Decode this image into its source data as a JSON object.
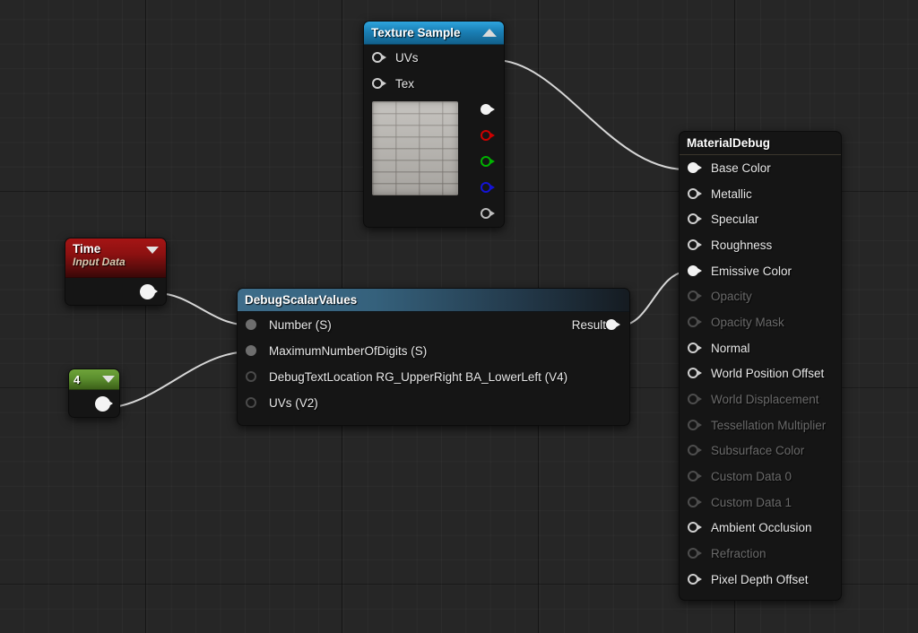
{
  "editor": {
    "name": "material-graph-editor",
    "background_color": "#262626",
    "wire_color": "#d7d7d7"
  },
  "nodes": {
    "texture_sample": {
      "title": "Texture Sample",
      "collapse_icon": "chevron-up-icon",
      "header_color": "#1a7fb5",
      "inputs": [
        {
          "label": "UVs",
          "connected": false
        },
        {
          "label": "Tex",
          "connected": false
        }
      ],
      "outputs": [
        {
          "label": "",
          "color": "#ffffff",
          "connected": true
        },
        {
          "label": "",
          "color": "#cc0000",
          "connected": false
        },
        {
          "label": "",
          "color": "#00b300",
          "connected": false
        },
        {
          "label": "",
          "color": "#1414d6",
          "connected": false
        },
        {
          "label": "",
          "color": "#bdbdbd",
          "connected": false
        }
      ],
      "preview": "brick-texture-thumbnail"
    },
    "material_debug": {
      "title": "MaterialDebug",
      "header_color": "#9b8f79",
      "inputs": [
        {
          "label": "Base Color",
          "enabled": true,
          "connected": true
        },
        {
          "label": "Metallic",
          "enabled": true,
          "connected": false
        },
        {
          "label": "Specular",
          "enabled": true,
          "connected": false
        },
        {
          "label": "Roughness",
          "enabled": true,
          "connected": false
        },
        {
          "label": "Emissive Color",
          "enabled": true,
          "connected": true
        },
        {
          "label": "Opacity",
          "enabled": false,
          "connected": false
        },
        {
          "label": "Opacity Mask",
          "enabled": false,
          "connected": false
        },
        {
          "label": "Normal",
          "enabled": true,
          "connected": false
        },
        {
          "label": "World Position Offset",
          "enabled": true,
          "connected": false
        },
        {
          "label": "World Displacement",
          "enabled": false,
          "connected": false
        },
        {
          "label": "Tessellation Multiplier",
          "enabled": false,
          "connected": false
        },
        {
          "label": "Subsurface Color",
          "enabled": false,
          "connected": false
        },
        {
          "label": "Custom Data 0",
          "enabled": false,
          "connected": false
        },
        {
          "label": "Custom Data 1",
          "enabled": false,
          "connected": false
        },
        {
          "label": "Ambient Occlusion",
          "enabled": true,
          "connected": false
        },
        {
          "label": "Refraction",
          "enabled": false,
          "connected": false
        },
        {
          "label": "Pixel Depth Offset",
          "enabled": true,
          "connected": false
        }
      ]
    },
    "debug_scalar_values": {
      "title": "DebugScalarValues",
      "header_color": "#35617c",
      "inputs": [
        {
          "label": "Number (S)",
          "connected": true
        },
        {
          "label": "MaximumNumberOfDigits (S)",
          "connected": true
        },
        {
          "label": "DebugTextLocation RG_UpperRight BA_LowerLeft (V4)",
          "connected": false
        },
        {
          "label": "UVs (V2)",
          "connected": false
        }
      ],
      "outputs": [
        {
          "label": "Result",
          "connected": true
        }
      ]
    },
    "time": {
      "title": "Time",
      "subtitle": "Input Data",
      "header_color": "#8d1111",
      "dropdown_icon": "chevron-down-icon",
      "outputs": [
        {
          "label": "",
          "connected": true
        }
      ]
    },
    "constant_4": {
      "value": "4",
      "header_color": "#5c8f2e",
      "dropdown_icon": "chevron-down-icon",
      "outputs": [
        {
          "label": "",
          "connected": true
        }
      ]
    }
  },
  "connections": [
    {
      "from": "texture_sample.rgb",
      "to": "material_debug.base_color"
    },
    {
      "from": "time.out",
      "to": "debug_scalar_values.number"
    },
    {
      "from": "constant_4.out",
      "to": "debug_scalar_values.maximum_number_of_digits"
    },
    {
      "from": "debug_scalar_values.result",
      "to": "material_debug.emissive_color"
    }
  ]
}
